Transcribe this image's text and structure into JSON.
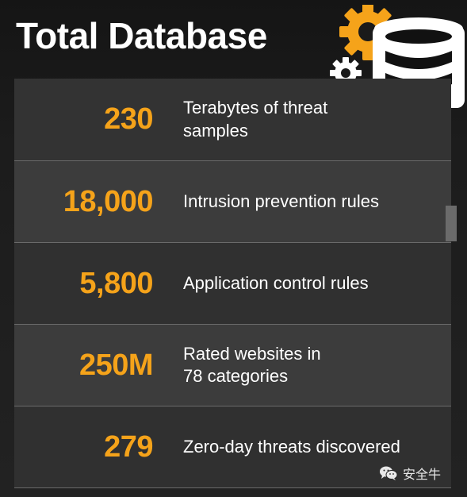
{
  "title": "Total Database",
  "icons": {
    "gear": "gear-icon",
    "small_gear": "small-gear-icon",
    "database": "database-icon",
    "wechat": "wechat-icon"
  },
  "colors": {
    "accent": "#f5a31a",
    "text": "#ffffff",
    "background": "#1b1b1b"
  },
  "stats": [
    {
      "value": "230",
      "line1": "Terabytes of threat",
      "line2": "samples"
    },
    {
      "value": "18,000",
      "line1": "Intrusion prevention rules",
      "line2": ""
    },
    {
      "value": "5,800",
      "line1": "Application control rules",
      "line2": ""
    },
    {
      "value": "250M",
      "line1": "Rated websites in",
      "line2": "78 categories"
    },
    {
      "value": "279",
      "line1": "Zero-day threats discovered",
      "line2": ""
    }
  ],
  "watermark": {
    "text": "安全牛"
  }
}
